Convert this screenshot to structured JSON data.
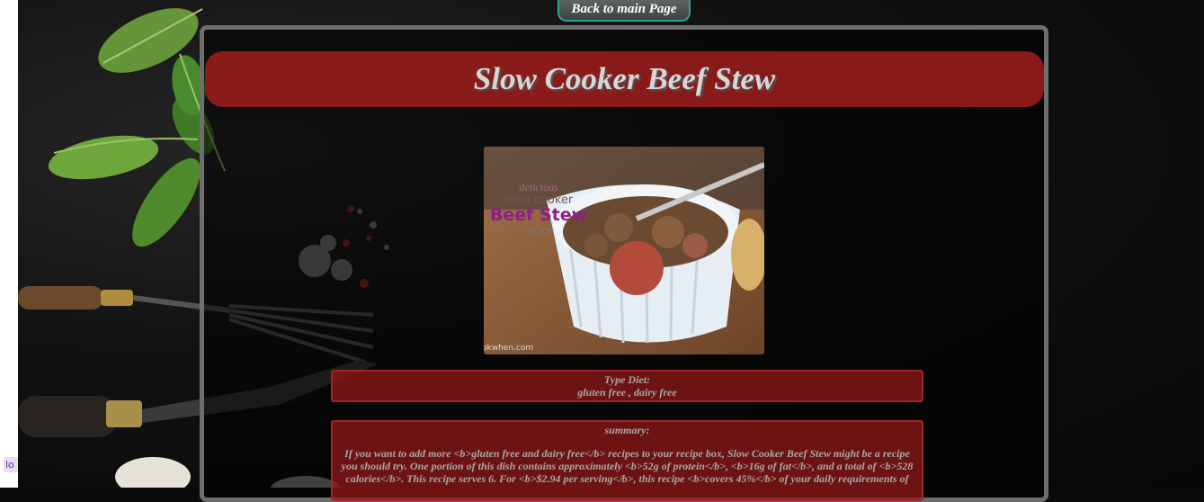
{
  "side_tab": {
    "label": "lo"
  },
  "nav": {
    "back_label": "Back to main Page"
  },
  "recipe": {
    "title": "Slow Cooker Beef Stew",
    "image_text": {
      "line1": "delicious",
      "line2": "slow cooker",
      "line3": "Beef Stew",
      "line4": "recipe",
      "watermark": "okwhen.com"
    },
    "diet": {
      "heading": "Type Diet:",
      "value": "gluten free , dairy free"
    },
    "summary": {
      "heading": "summary:",
      "text": "If you want to add more <b>gluten free and dairy free</b> recipes to your recipe box, Slow Cooker Beef Stew might be a recipe you should try. One portion of this dish contains approximately <b>52g of protein</b>, <b>16g of fat</b>, and a total of <b>528 calories</b>. This recipe serves 6. For <b>$2.94 per serving</b>, this recipe <b>covers 45%</b> of your daily requirements of"
    }
  },
  "colors": {
    "title_bar": "#a51e1e",
    "panel_border": "#6e6e6e",
    "back_button_border": "#27a58f",
    "info_box": "#961919"
  }
}
